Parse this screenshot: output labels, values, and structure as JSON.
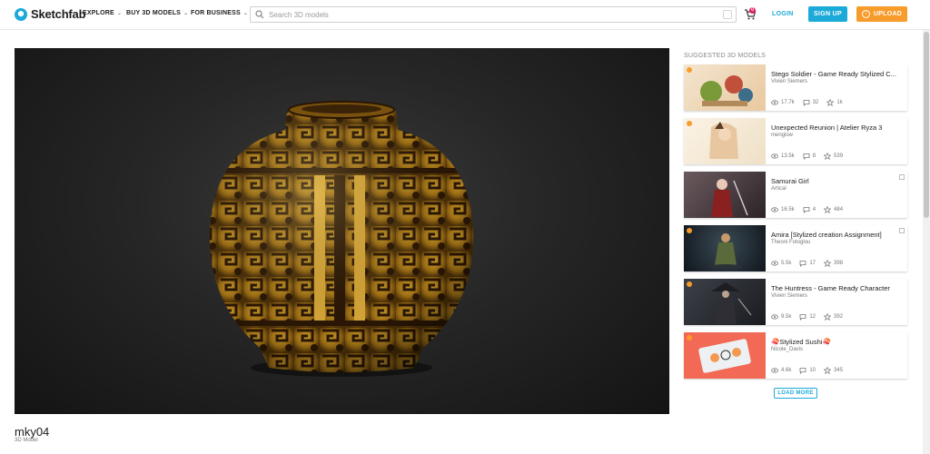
{
  "header": {
    "logo_text": "Sketchfab",
    "nav": [
      "EXPLORE",
      "BUY 3D MODELS",
      "FOR BUSINESS"
    ],
    "search_placeholder": "Search 3D models",
    "cart_count": "0",
    "login_label": "LOGIN",
    "signup_label": "SIGN UP",
    "upload_label": "UPLOAD"
  },
  "model": {
    "title": "mky04",
    "subtitle": "3D Model"
  },
  "suggested": {
    "heading": "SUGGESTED 3D MODELS",
    "items": [
      {
        "title": "Stego Soldier - Game Ready Stylized C...",
        "author": "Vivien Siemers",
        "views": "17.7k",
        "comments": "32",
        "likes": "1k"
      },
      {
        "title": "Unexpected Reunion | Atelier Ryza 3",
        "author": "menglow",
        "views": "13.5k",
        "comments": "8",
        "likes": "539"
      },
      {
        "title": "Samurai Girl",
        "author": "Artical",
        "views": "16.5k",
        "comments": "4",
        "likes": "484"
      },
      {
        "title": "Amira [Stylized creation Assignment]",
        "author": "Theoni Fotoglou",
        "views": "5.5k",
        "comments": "17",
        "likes": "398"
      },
      {
        "title": "The Huntress - Game Ready Character",
        "author": "Vivien Siemers",
        "views": "9.5k",
        "comments": "12",
        "likes": "392"
      },
      {
        "title": "🍣Stylized Sushi🍣",
        "author": "Nicole_Davis",
        "views": "4.6k",
        "comments": "10",
        "likes": "345"
      }
    ],
    "load_more": "LOAD MORE"
  },
  "colors": {
    "brand": "#1caad9",
    "upload": "#f79c2c",
    "viewer_bg": "#262626"
  },
  "icons": [
    "logo-icon",
    "search-icon",
    "cart-icon",
    "upload-icon",
    "eye-icon",
    "comment-icon",
    "star-icon",
    "chevron-down-icon"
  ]
}
